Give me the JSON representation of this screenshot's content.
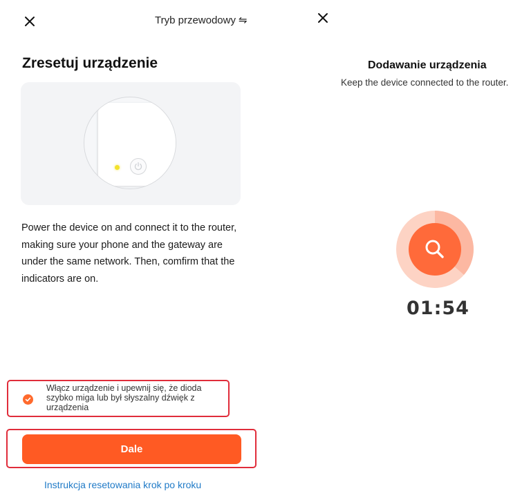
{
  "left_screen": {
    "close_icon": "close-icon",
    "mode_label": "Tryb przewodowy",
    "mode_icon": "⇋",
    "title": "Zresetuj urządzenie",
    "instructions": "Power the device on and connect it to the router, making sure your phone and the gateway are under the same network. Then, comfirm that the indicators are on.",
    "confirm_checkbox_label": "Włącz urządzenie i upewnij się, że dioda szybko miga lub był słyszalny dźwięk z urządzenia",
    "confirm_checked": true,
    "next_button_label": "Dale",
    "guide_link": "Instrukcja resetowania krok po kroku",
    "colors": {
      "accent": "#ff5a23",
      "led": "#f3e22c",
      "highlight_border": "#e02c3a",
      "link": "#1f7ac7"
    }
  },
  "right_screen": {
    "close_icon": "close-icon",
    "title": "Dodawanie urządzenia",
    "subtitle": "Keep the device connected to the router.",
    "search_icon": "search-icon",
    "timer": "01:54",
    "colors": {
      "spinner_outer": "#fbb9a3",
      "spinner_inner": "#ff6a3a"
    }
  }
}
